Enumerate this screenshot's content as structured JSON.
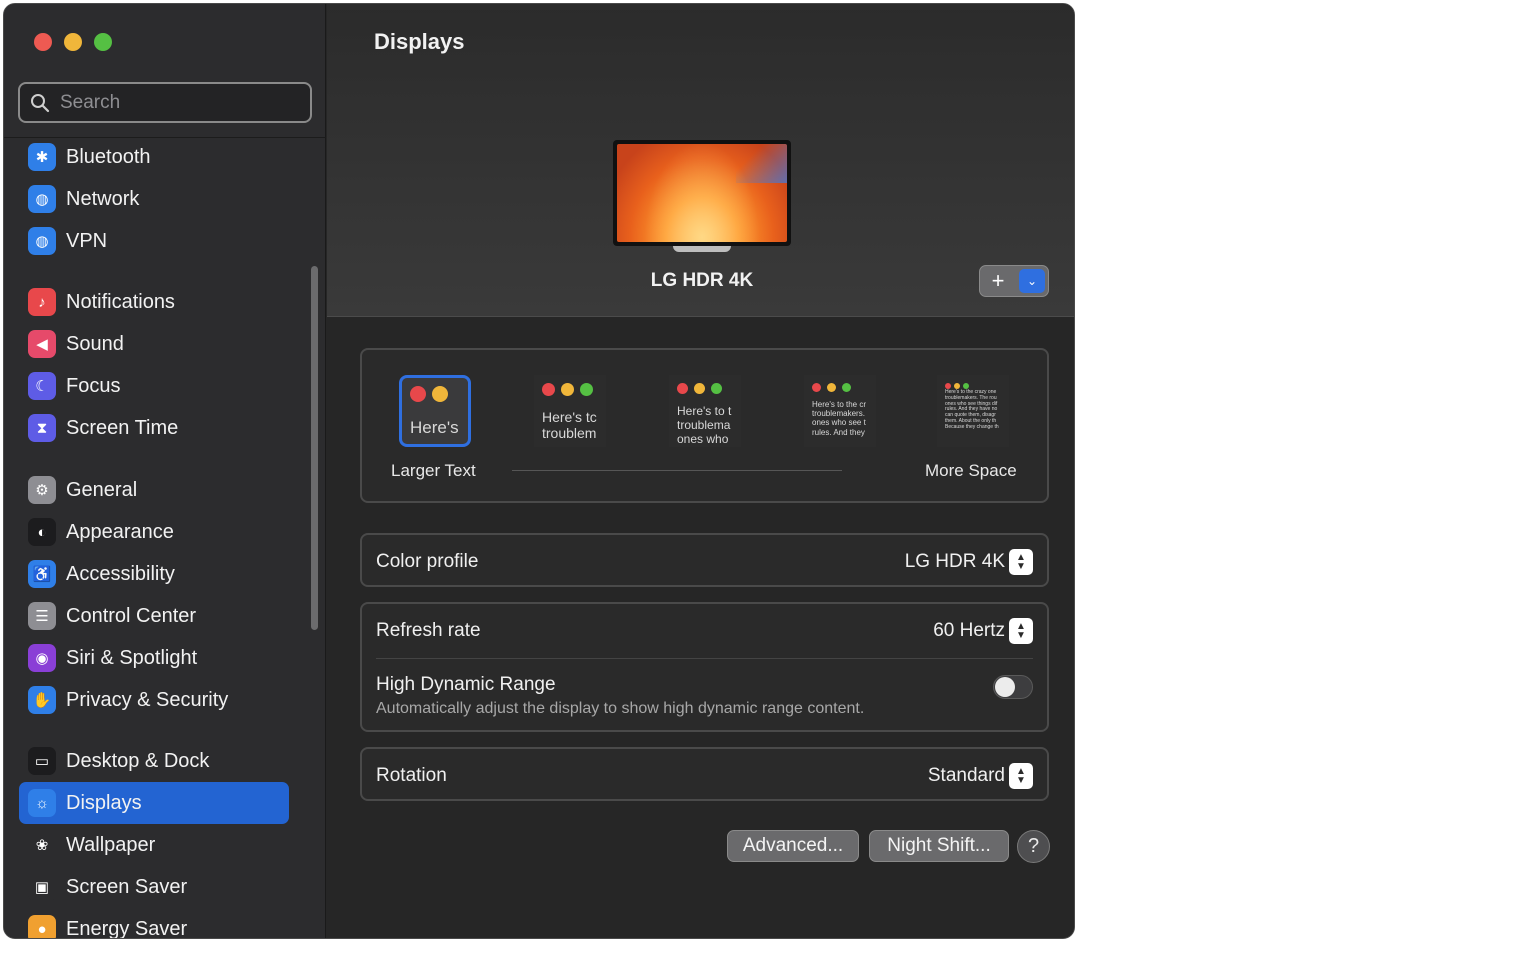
{
  "window": {
    "title": "Displays"
  },
  "search": {
    "placeholder": "Search"
  },
  "sidebar": {
    "items": [
      {
        "label": "Bluetooth",
        "icon": "bluetooth-icon",
        "color": "#2f7fe8",
        "glyph": "✱"
      },
      {
        "label": "Network",
        "icon": "globe-icon",
        "color": "#2f7fe8",
        "glyph": "◍"
      },
      {
        "label": "VPN",
        "icon": "vpn-globe-icon",
        "color": "#2f7fe8",
        "glyph": "◍"
      },
      {
        "label": "Notifications",
        "icon": "bell-icon",
        "color": "#e8484b",
        "glyph": "♪"
      },
      {
        "label": "Sound",
        "icon": "speaker-icon",
        "color": "#e64a6a",
        "glyph": "◀"
      },
      {
        "label": "Focus",
        "icon": "moon-icon",
        "color": "#5e5ce6",
        "glyph": "☾"
      },
      {
        "label": "Screen Time",
        "icon": "hourglass-icon",
        "color": "#5e5ce6",
        "glyph": "⧗"
      },
      {
        "label": "General",
        "icon": "gear-icon",
        "color": "#8e8e93",
        "glyph": "⚙"
      },
      {
        "label": "Appearance",
        "icon": "appearance-icon",
        "color": "#1c1c1e",
        "glyph": "◐"
      },
      {
        "label": "Accessibility",
        "icon": "accessibility-icon",
        "color": "#2f7fe8",
        "glyph": "♿"
      },
      {
        "label": "Control Center",
        "icon": "toggles-icon",
        "color": "#8e8e93",
        "glyph": "☰"
      },
      {
        "label": "Siri & Spotlight",
        "icon": "siri-icon",
        "color": "#8a3fd6",
        "glyph": "◉"
      },
      {
        "label": "Privacy & Security",
        "icon": "hand-icon",
        "color": "#2f7fe8",
        "glyph": "✋"
      },
      {
        "label": "Desktop & Dock",
        "icon": "dock-icon",
        "color": "#1c1c1e",
        "glyph": "▭"
      },
      {
        "label": "Displays",
        "icon": "sun-icon",
        "color": "#2f7fe8",
        "glyph": "☼",
        "selected": true
      },
      {
        "label": "Wallpaper",
        "icon": "flower-icon",
        "color": "#2c2c2e",
        "glyph": "❀"
      },
      {
        "label": "Screen Saver",
        "icon": "screensaver-icon",
        "color": "#2c2c2e",
        "glyph": "▣"
      },
      {
        "label": "Energy Saver",
        "icon": "bulb-icon",
        "color": "#f0a030",
        "glyph": "●"
      }
    ]
  },
  "display": {
    "name": "LG HDR 4K",
    "add_label": "+"
  },
  "resolution": {
    "larger_label": "Larger Text",
    "more_label": "More Space",
    "options": [
      {
        "text": "Here's",
        "selected": true
      },
      {
        "text": "Here's tc\ntroublem"
      },
      {
        "text": "Here's to t\ntroublema\nones who"
      },
      {
        "text": "Here's to the cr\ntroublemakers.\nones who see t\nrules. And they"
      },
      {
        "text": "Here's to the crazy one\ntroublemakers. The rou\nones who see things dif\nrules. And they have no\ncan quote them, disagr\nthem. About the only th\nBecause they change th"
      }
    ]
  },
  "settings": {
    "color_profile": {
      "label": "Color profile",
      "value": "LG HDR 4K"
    },
    "refresh_rate": {
      "label": "Refresh rate",
      "value": "60 Hertz"
    },
    "hdr": {
      "label": "High Dynamic Range",
      "description": "Automatically adjust the display to show high dynamic range content.",
      "enabled": false
    },
    "rotation": {
      "label": "Rotation",
      "value": "Standard"
    }
  },
  "buttons": {
    "advanced": "Advanced...",
    "night_shift": "Night Shift...",
    "help": "?"
  }
}
